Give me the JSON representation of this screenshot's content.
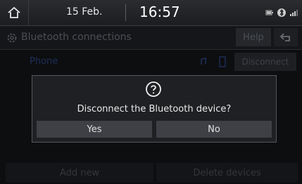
{
  "status": {
    "date": "15 Feb.",
    "time": "16:57"
  },
  "header": {
    "title": "Bluetooth connections",
    "help_label": "Help"
  },
  "device": {
    "name": "Phone",
    "disconnect_label": "Disconnect"
  },
  "actions": {
    "add_new_label": "Add new",
    "delete_devices_label": "Delete devices"
  },
  "dialog": {
    "message": "Disconnect the Bluetooth device?",
    "yes_label": "Yes",
    "no_label": "No"
  },
  "icons": {
    "home": "home-icon",
    "settings": "gear-icon",
    "back": "back-arrow-icon",
    "question": "question-icon",
    "battery": "battery-icon",
    "bluetooth": "bluetooth-icon",
    "signal": "signal-icon",
    "audio": "audio-stream-icon",
    "phone": "phone-icon"
  },
  "colors": {
    "background": "#0d0e10",
    "dialog_bg": "#1f2023",
    "dialog_button": "#3e4045",
    "accent_blue": "#1f2e5a"
  }
}
